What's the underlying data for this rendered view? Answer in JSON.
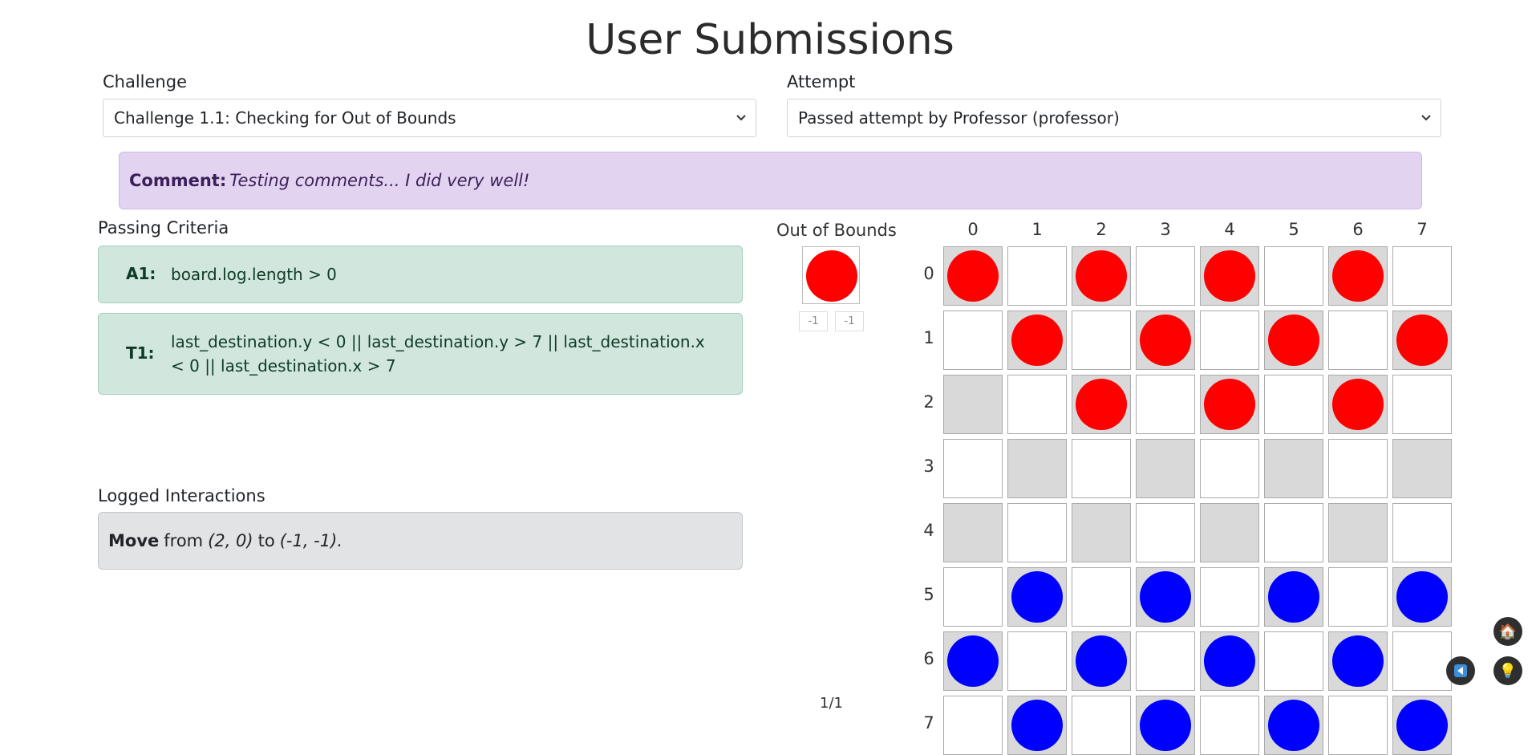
{
  "page_title": "User Submissions",
  "challenge": {
    "label": "Challenge",
    "selected": "Challenge 1.1: Checking for Out of Bounds"
  },
  "attempt": {
    "label": "Attempt",
    "selected": "Passed attempt by Professor (professor)"
  },
  "comment": {
    "label": "Comment:",
    "text": "Testing comments... I did very well!"
  },
  "passing_criteria": {
    "title": "Passing Criteria",
    "items": [
      {
        "id": "A1:",
        "expr": "board.log.length > 0"
      },
      {
        "id": "T1:",
        "expr": "last_destination.y < 0 || last_destination.y > 7 || last_destination.x < 0 || last_destination.x > 7"
      }
    ]
  },
  "logged_interactions": {
    "title": "Logged Interactions",
    "items": [
      {
        "action": "Move",
        "from_word": "from",
        "from": "(2, 0)",
        "to_word": "to",
        "to": "(-1, -1)."
      }
    ]
  },
  "out_of_bounds": {
    "label": "Out of Bounds",
    "piece_color": "red",
    "coords": [
      "-1",
      "-1"
    ]
  },
  "board": {
    "col_labels": [
      "0",
      "1",
      "2",
      "3",
      "4",
      "5",
      "6",
      "7"
    ],
    "row_labels": [
      "0",
      "1",
      "2",
      "3",
      "4",
      "5",
      "6",
      "7"
    ],
    "rows": [
      [
        "r",
        "",
        "r",
        "",
        "r",
        "",
        "r",
        ""
      ],
      [
        "",
        "r",
        "",
        "r",
        "",
        "r",
        "",
        "r"
      ],
      [
        "",
        "",
        "r",
        "",
        "r",
        "",
        "r",
        ""
      ],
      [
        "",
        "",
        "",
        "",
        "",
        "",
        "",
        ""
      ],
      [
        "",
        "",
        "",
        "",
        "",
        "",
        "",
        ""
      ],
      [
        "",
        "b",
        "",
        "b",
        "",
        "b",
        "",
        "b"
      ],
      [
        "b",
        "",
        "b",
        "",
        "b",
        "",
        "b",
        ""
      ],
      [
        "",
        "b",
        "",
        "b",
        "",
        "b",
        "",
        "b"
      ]
    ]
  },
  "pager": "1/1",
  "colors": {
    "red_piece": "#ff0000",
    "blue_piece": "#0000ff",
    "dark_square": "#d9d9d9",
    "comment_bg": "#e2d4f1",
    "criteria_bg": "#d1e7dd",
    "log_bg": "#e2e3e5"
  },
  "icons": [
    "chevron-down-icon",
    "home-icon",
    "back-arrow-icon",
    "lightbulb-icon"
  ]
}
